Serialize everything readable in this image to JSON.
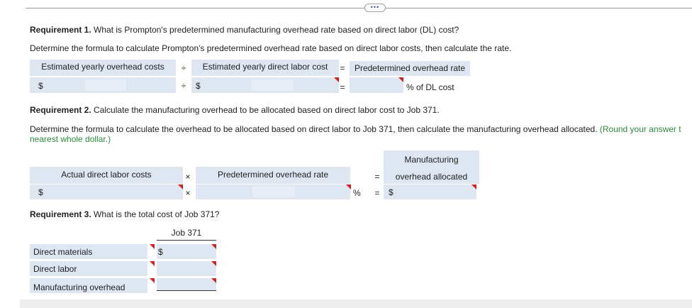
{
  "toolbar": {
    "more_label": "•••"
  },
  "req1": {
    "heading": "Requirement 1.",
    "question": "What is Prompton's predetermined manufacturing overhead rate based on direct labor (DL) cost?",
    "instruction": "Determine the formula to calculate Prompton's predetermined overhead rate based on direct labor costs, then calculate the rate.",
    "col1": "Estimated yearly overhead costs",
    "op1": "÷",
    "col2": "Estimated yearly direct labor cost",
    "op2": "=",
    "col3": "Predetermined overhead rate",
    "dollar1": "$",
    "op1b": "÷",
    "dollar2": "$",
    "op2b": "=",
    "unit": "% of DL cost"
  },
  "req2": {
    "heading": "Requirement 2.",
    "question": "Calculate the manufacturing overhead to be allocated based on direct labor cost to Job 371.",
    "instruction": "Determine the formula to calculate the overhead to be allocated based on direct labor to Job 371, then calculate the manufacturing overhead allocated.",
    "note": "(Round your answer to the nearest whole dollar.)",
    "note_line1": "(Round your answer t",
    "note_line2": "nearest whole dollar.)",
    "col1": "Actual direct labor costs",
    "op1": "×",
    "col2": "Predetermined overhead rate",
    "op2": "=",
    "col3_line1": "Manufacturing",
    "col3_line2": "overhead allocated",
    "dollar1": "$",
    "op1b": "×",
    "pct": "%",
    "op2b": "=",
    "dollar2": "$"
  },
  "req3": {
    "heading": "Requirement 3.",
    "question": "What is the total cost of Job 371?",
    "col_header": "Job 371",
    "rows": [
      {
        "label": "Direct materials",
        "prefix": "$"
      },
      {
        "label": "Direct labor",
        "prefix": ""
      },
      {
        "label": "Manufacturing overhead",
        "prefix": ""
      }
    ]
  },
  "colors": {
    "header_bg": "#dde6f1",
    "marker": "#d42020",
    "note": "#2c8a3c"
  }
}
